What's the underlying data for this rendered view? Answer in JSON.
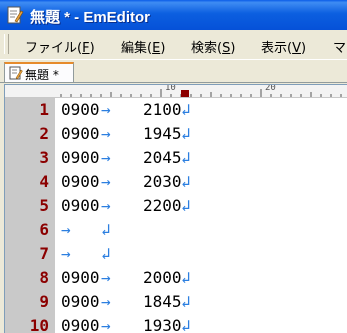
{
  "window": {
    "title": "無題 * - EmEditor",
    "icon": "document-pencil-icon"
  },
  "menu": {
    "items": [
      {
        "label": "ファイル",
        "accel": "F"
      },
      {
        "label": "編集",
        "accel": "E"
      },
      {
        "label": "検索",
        "accel": "S"
      },
      {
        "label": "表示",
        "accel": "V"
      },
      {
        "label": "マ",
        "accel": ""
      }
    ]
  },
  "tabs": [
    {
      "label": "無題 *",
      "active": true
    }
  ],
  "ruler": {
    "labels": [
      "10",
      "20"
    ]
  },
  "editor": {
    "tab_glyph": "→",
    "eol_glyph": "↲",
    "lines": [
      {
        "number": "1",
        "start": "0900",
        "end": "2100"
      },
      {
        "number": "2",
        "start": "0900",
        "end": "1945"
      },
      {
        "number": "3",
        "start": "0900",
        "end": "2045"
      },
      {
        "number": "4",
        "start": "0900",
        "end": "2030"
      },
      {
        "number": "5",
        "start": "0900",
        "end": "2200"
      },
      {
        "number": "6",
        "start": "",
        "end": ""
      },
      {
        "number": "7",
        "start": "",
        "end": ""
      },
      {
        "number": "8",
        "start": "0900",
        "end": "2000"
      },
      {
        "number": "9",
        "start": "0900",
        "end": "1845"
      },
      {
        "number": "10",
        "start": "0900",
        "end": "1930"
      }
    ]
  },
  "colors": {
    "line_number": "#8b0000",
    "marks": "#2c7fe0",
    "gutter": "#c9c9c9"
  }
}
